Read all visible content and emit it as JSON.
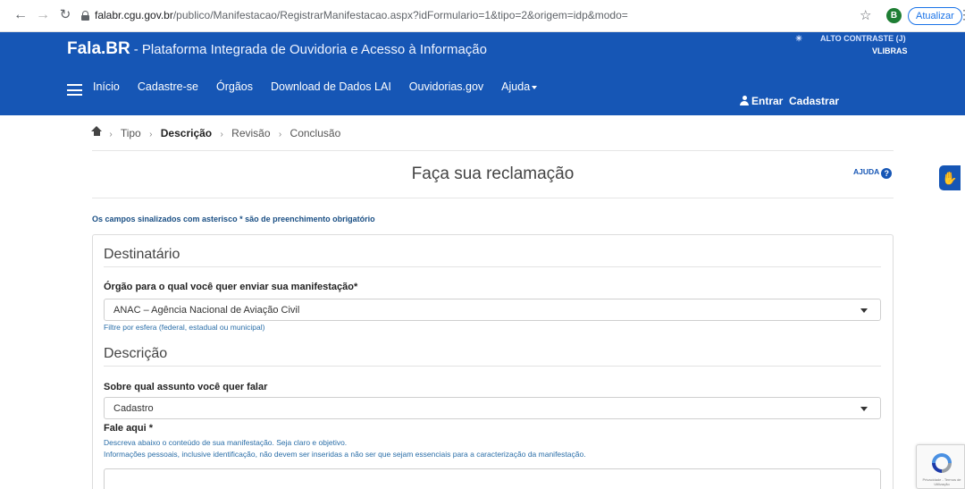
{
  "browser": {
    "url_host": "falabr.cgu.gov.br",
    "url_path": "/publico/Manifestacao/RegistrarManifestacao.aspx?idFormulario=1&tipo=2&origem=idp&modo=",
    "profile_initial": "B",
    "update_label": "Atualizar"
  },
  "header": {
    "logo": "Fala.BR",
    "tagline": "- Plataforma Integrada de Ouvidoria e Acesso à Informação",
    "contrast_label": "ALTO CONTRASTE (J)",
    "vlibras_label": "VLIBRAS",
    "nav": [
      {
        "label": "Início"
      },
      {
        "label": "Cadastre-se"
      },
      {
        "label": "Órgãos"
      },
      {
        "label": "Download de Dados LAI"
      },
      {
        "label": "Ouvidorias.gov"
      },
      {
        "label": "Ajuda"
      }
    ],
    "login_label": "Entrar",
    "register_label": "Cadastrar"
  },
  "breadcrumb": {
    "steps": [
      "Tipo",
      "Descrição",
      "Revisão",
      "Conclusão"
    ],
    "current_index": 1
  },
  "page": {
    "title": "Faça sua reclamação",
    "help_label": "AJUDA",
    "required_note": "Os campos sinalizados com asterisco * são de preenchimento obrigatório"
  },
  "form": {
    "destinatario_title": "Destinatário",
    "orgao_label": "Órgão para o qual você quer enviar sua manifestação*",
    "orgao_value": "ANAC – Agência Nacional de Aviação Civil",
    "orgao_hint": "Filtre por esfera (federal, estadual ou municipal)",
    "descricao_title": "Descrição",
    "assunto_label": "Sobre qual assunto você quer falar",
    "assunto_value": "Cadastro",
    "fale_label": "Fale aqui *",
    "fale_hint_1": "Descreva abaixo o conteúdo de sua manifestação. Seja claro e objetivo.",
    "fale_hint_2": "Informações pessoais, inclusive identificação, não devem ser inseridas a não ser que sejam essenciais para a caracterização da manifestação."
  },
  "recaptcha": {
    "text": "Privacidade - Termos de Utilização"
  },
  "colors": {
    "header_blue": "#1656b5",
    "link_blue": "#1a4f84"
  }
}
